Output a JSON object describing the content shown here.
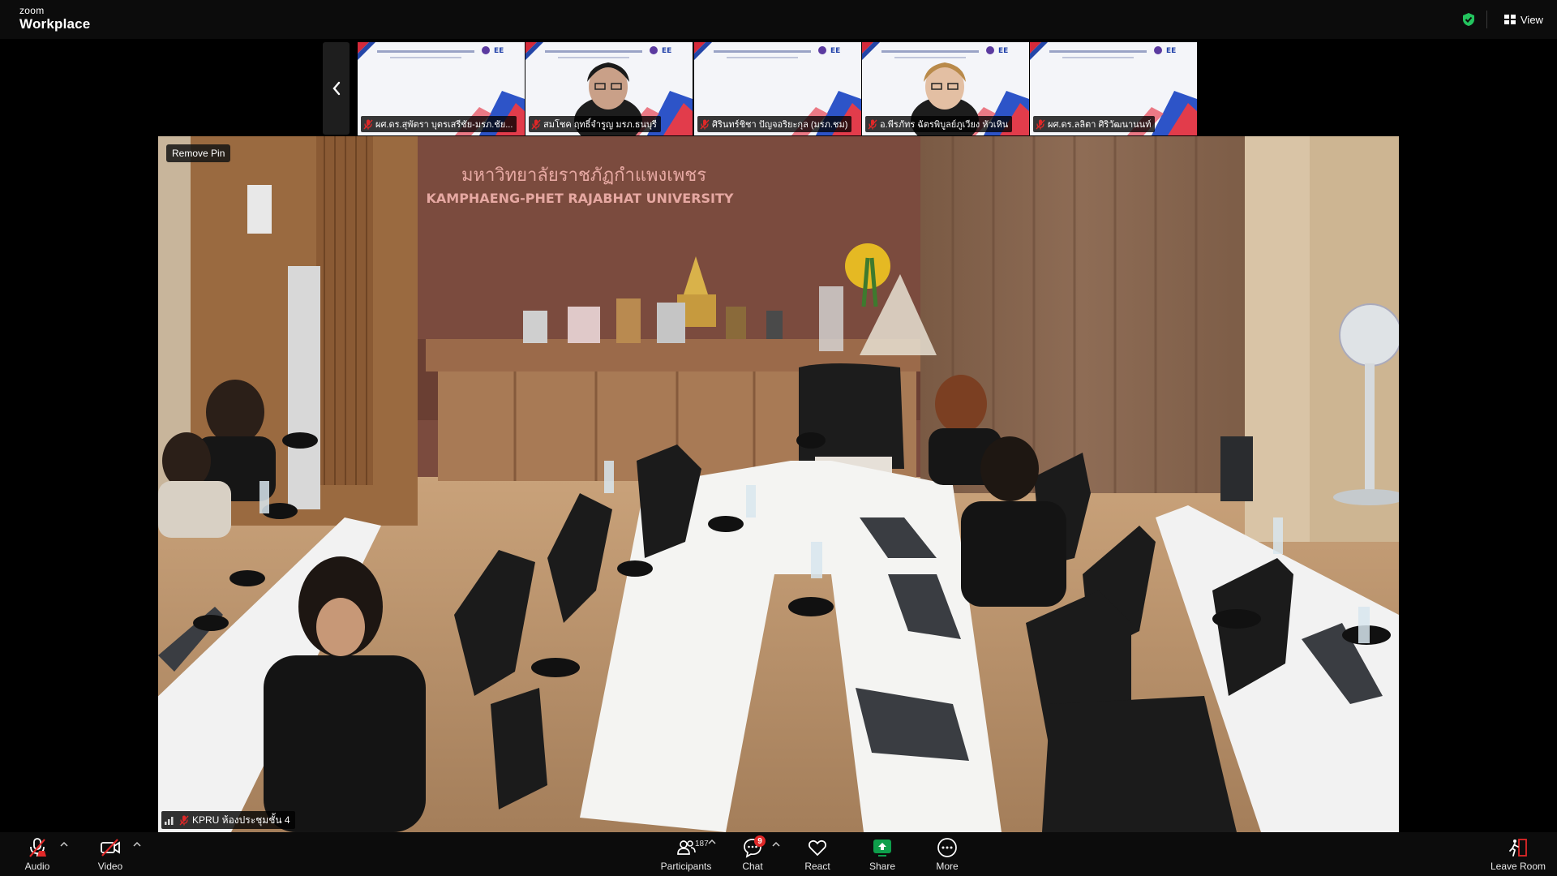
{
  "app": {
    "brand_small": "zoom",
    "brand_large": "Workplace",
    "view_label": "View"
  },
  "colors": {
    "background": "#000000",
    "bar": "#0c0c0c",
    "muted_red": "#e02828",
    "share_green": "#0e9e4b",
    "shield_green": "#23c45e"
  },
  "participants_strip": [
    {
      "name": "ผศ.ดร.สุพัตรา บุตรเสรีชัย-มรภ.ชัย...",
      "muted": true
    },
    {
      "name": "สมโชค ฤทธิ์จำรูญ มรภ.ธนบุรี",
      "muted": true
    },
    {
      "name": "ศิรินทร์ชิชา ปัญจอริยะกุล (มรภ.ชม)",
      "muted": true
    },
    {
      "name": "อ.พีรภัทร ฉัตรพิบูลย์ภูเวียง หัวเหิน",
      "muted": true
    },
    {
      "name": "ผศ.ดร.ลลิตา ศิริวัฒนานนท์",
      "muted": true
    }
  ],
  "main_video": {
    "remove_pin_label": "Remove Pin",
    "name": "KPRU ห้องประชุมชั้น 4",
    "muted": true,
    "wall_sign_thai": "มหาวิทยาลัยราชภัฏกำแพงเพชร",
    "wall_sign_english": "KAMPHAENG-PHET RAJABHAT UNIVERSITY"
  },
  "toolbar": {
    "audio_label": "Audio",
    "video_label": "Video",
    "participants_label": "Participants",
    "participants_count": "187",
    "chat_label": "Chat",
    "chat_unread": "9",
    "react_label": "React",
    "share_label": "Share",
    "more_label": "More",
    "leave_label": "Leave Room"
  }
}
